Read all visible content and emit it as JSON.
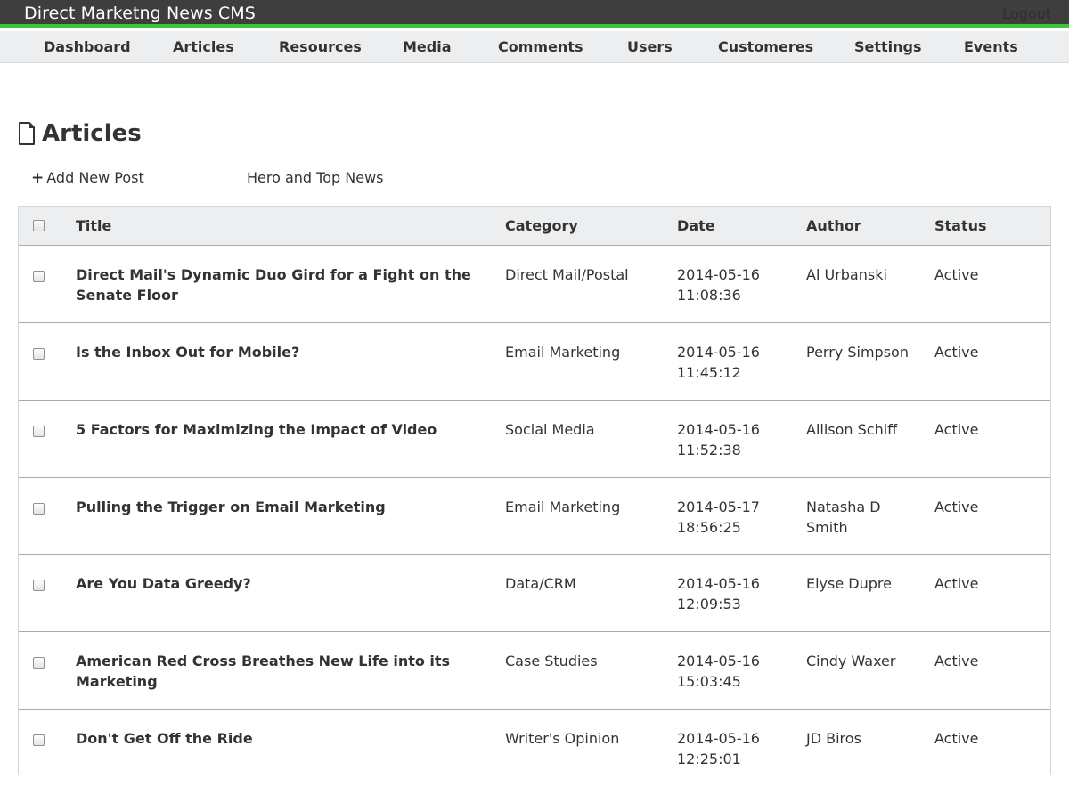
{
  "app": {
    "title": "Direct Marketng News CMS",
    "logout_label": "Logout"
  },
  "nav": {
    "items": [
      {
        "label": "Dashboard"
      },
      {
        "label": "Articles"
      },
      {
        "label": "Resources"
      },
      {
        "label": "Media"
      },
      {
        "label": "Comments"
      },
      {
        "label": "Users"
      },
      {
        "label": "Customeres"
      },
      {
        "label": "Settings"
      },
      {
        "label": "Events"
      }
    ]
  },
  "page": {
    "title": "Articles",
    "icon": "document-icon"
  },
  "actions": {
    "add_new_post": "Add New Post",
    "hero_top_news": "Hero and Top News"
  },
  "table": {
    "columns": {
      "title": "Title",
      "category": "Category",
      "date": "Date",
      "author": "Author",
      "status": "Status"
    },
    "rows": [
      {
        "title": "Direct Mail's Dynamic Duo Gird for a Fight on the Senate Floor",
        "category": "Direct Mail/Postal",
        "date": "2014-05-16 11:08:36",
        "author": "Al Urbanski",
        "status": "Active"
      },
      {
        "title": "Is the Inbox Out for Mobile?",
        "category": "Email Marketing",
        "date": "2014-05-16 11:45:12",
        "author": "Perry Simpson",
        "status": "Active"
      },
      {
        "title": "5 Factors for Maximizing the Impact of Video",
        "category": "Social Media",
        "date": "2014-05-16 11:52:38",
        "author": "Allison Schiff",
        "status": "Active"
      },
      {
        "title": "Pulling the Trigger on Email Marketing",
        "category": "Email Marketing",
        "date": "2014-05-17 18:56:25",
        "author": "Natasha D Smith",
        "status": "Active"
      },
      {
        "title": "Are You Data Greedy?",
        "category": "Data/CRM",
        "date": "2014-05-16 12:09:53",
        "author": "Elyse Dupre",
        "status": "Active"
      },
      {
        "title": "American Red Cross Breathes New Life into its Marketing",
        "category": "Case Studies",
        "date": "2014-05-16 15:03:45",
        "author": "Cindy Waxer",
        "status": "Active"
      },
      {
        "title": "Don't Get Off the Ride",
        "category": "Writer's Opinion",
        "date": "2014-05-16 12:25:01",
        "author": "JD Biros",
        "status": "Active"
      }
    ]
  },
  "colors": {
    "topbar": "#3e3e3e",
    "accent": "#3cc23c",
    "navbar": "#eceef0"
  }
}
